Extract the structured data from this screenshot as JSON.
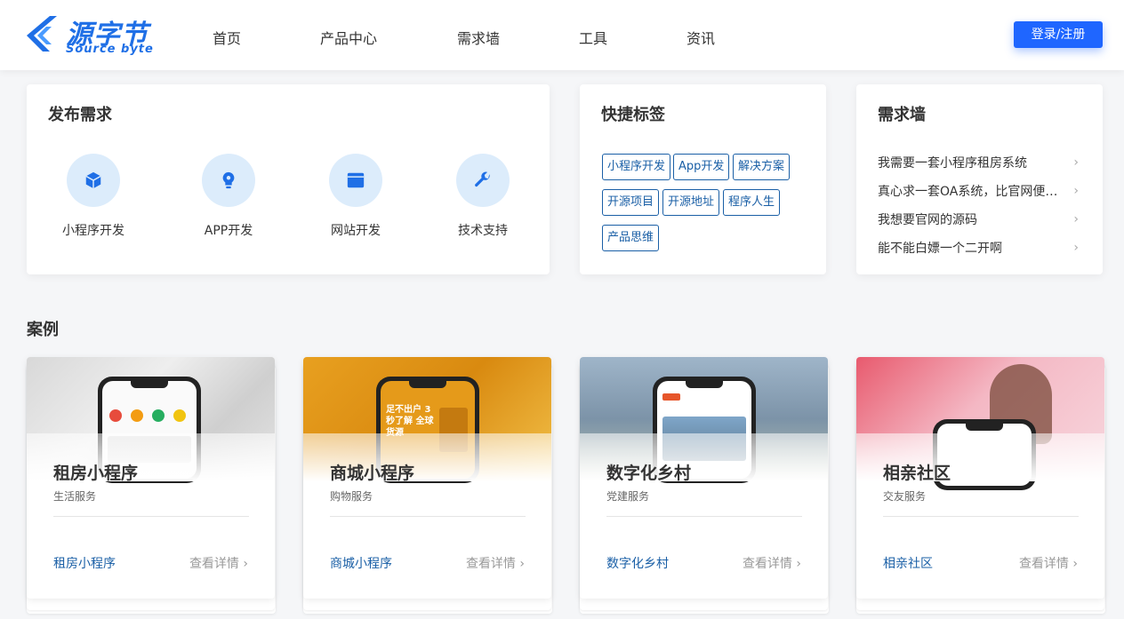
{
  "header": {
    "logo_title": "源字节",
    "logo_sub": "Source byte",
    "nav": [
      "首页",
      "产品中心",
      "需求墙",
      "工具",
      "资讯"
    ],
    "login_label": "登录/注册"
  },
  "publish": {
    "title": "发布需求",
    "items": [
      {
        "label": "小程序开发",
        "icon": "cube-icon"
      },
      {
        "label": "APP开发",
        "icon": "lightbulb-icon"
      },
      {
        "label": "网站开发",
        "icon": "browser-icon"
      },
      {
        "label": "技术支持",
        "icon": "wrench-icon"
      }
    ]
  },
  "tags": {
    "title": "快捷标签",
    "items": [
      "小程序开发",
      "App开发",
      "解决方案",
      "开源项目",
      "开源地址",
      "程序人生",
      "产品思维"
    ]
  },
  "wall": {
    "title": "需求墙",
    "items": [
      "我需要一套小程序租房系统",
      "真心求一套OA系统，比官网便宜的那种",
      "我想要官网的源码",
      "能不能白嫖一个二开啊"
    ]
  },
  "cases": {
    "title": "案例",
    "more_label": "查看详情",
    "items": [
      {
        "name": "租房小程序",
        "category": "生活服务",
        "link": "租房小程序"
      },
      {
        "name": "商城小程序",
        "category": "购物服务",
        "link": "商城小程序",
        "phone_text": "足不出户 3秒了解 全球货源"
      },
      {
        "name": "数字化乡村",
        "category": "党建服务",
        "link": "数字化乡村"
      },
      {
        "name": "相亲社区",
        "category": "交友服务",
        "link": "相亲社区"
      }
    ]
  },
  "colors": {
    "brand": "#1f6fe6",
    "accent": "#1f66ff",
    "link": "#1a5fa6"
  }
}
